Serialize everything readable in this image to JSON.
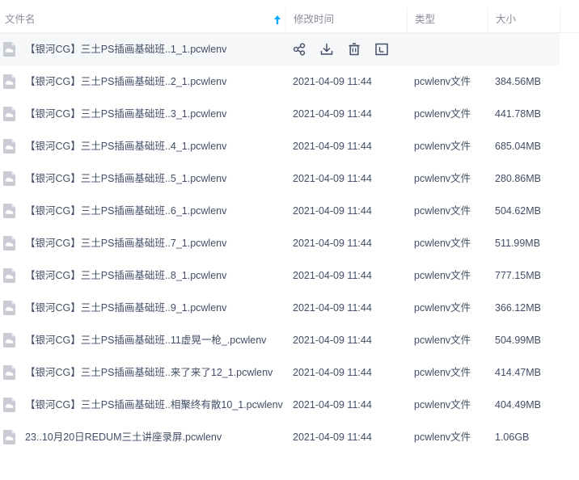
{
  "header": {
    "name": "文件名",
    "time": "修改时间",
    "type": "类型",
    "size": "大小"
  },
  "icons": {
    "file": "cloud-file-icon",
    "sort": "sort-ascending-icon",
    "share": "share-icon",
    "download": "download-icon",
    "delete": "delete-icon",
    "rename": "rename-icon"
  },
  "rows": [
    {
      "name": "【银河CG】三土PS插画基础班..1_1.pcwlenv",
      "time": "",
      "type": "",
      "size": "",
      "hovered": true
    },
    {
      "name": "【银河CG】三土PS插画基础班..2_1.pcwlenv",
      "time": "2021-04-09 11:44",
      "type": "pcwlenv文件",
      "size": "384.56MB"
    },
    {
      "name": "【银河CG】三土PS插画基础班..3_1.pcwlenv",
      "time": "2021-04-09 11:44",
      "type": "pcwlenv文件",
      "size": "441.78MB"
    },
    {
      "name": "【银河CG】三土PS插画基础班..4_1.pcwlenv",
      "time": "2021-04-09 11:44",
      "type": "pcwlenv文件",
      "size": "685.04MB"
    },
    {
      "name": "【银河CG】三土PS插画基础班..5_1.pcwlenv",
      "time": "2021-04-09 11:44",
      "type": "pcwlenv文件",
      "size": "280.86MB"
    },
    {
      "name": "【银河CG】三土PS插画基础班..6_1.pcwlenv",
      "time": "2021-04-09 11:44",
      "type": "pcwlenv文件",
      "size": "504.62MB"
    },
    {
      "name": "【银河CG】三土PS插画基础班..7_1.pcwlenv",
      "time": "2021-04-09 11:44",
      "type": "pcwlenv文件",
      "size": "511.99MB"
    },
    {
      "name": "【银河CG】三土PS插画基础班..8_1.pcwlenv",
      "time": "2021-04-09 11:44",
      "type": "pcwlenv文件",
      "size": "777.15MB"
    },
    {
      "name": "【银河CG】三土PS插画基础班..9_1.pcwlenv",
      "time": "2021-04-09 11:44",
      "type": "pcwlenv文件",
      "size": "366.12MB"
    },
    {
      "name": "【银河CG】三土PS插画基础班..11虚晃一枪_.pcwlenv",
      "time": "2021-04-09 11:44",
      "type": "pcwlenv文件",
      "size": "504.99MB"
    },
    {
      "name": "【银河CG】三土PS插画基础班..来了来了12_1.pcwlenv",
      "time": "2021-04-09 11:44",
      "type": "pcwlenv文件",
      "size": "414.47MB"
    },
    {
      "name": "【银河CG】三土PS插画基础班..相聚终有散10_1.pcwlenv",
      "time": "2021-04-09 11:44",
      "type": "pcwlenv文件",
      "size": "404.49MB"
    },
    {
      "name": "23..10月20日REDUM三土讲座录屏.pcwlenv",
      "time": "2021-04-09 11:44",
      "type": "pcwlenv文件",
      "size": "1.06GB"
    }
  ],
  "colors": {
    "text": "#424e67",
    "header_text": "#878c9c",
    "accent": "#06a7ff",
    "hover_row": "#f6f7f9",
    "icon_gray": "#c8cbd1"
  }
}
